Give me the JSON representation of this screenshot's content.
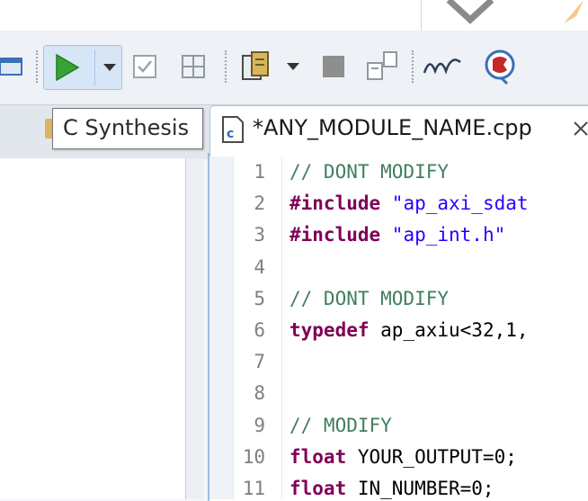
{
  "tooltip": {
    "text": "C Synthesis"
  },
  "editor": {
    "active_tab": {
      "label": "*ANY_MODULE_NAME.cpp"
    },
    "lines": [
      {
        "num": "1",
        "text": "// DONT MODIFY"
      },
      {
        "num": "2",
        "kw": "#include",
        "str": " \"ap_axi_sdat"
      },
      {
        "num": "3",
        "kw": "#include",
        "str": " \"ap_int.h\""
      },
      {
        "num": "4",
        "text": ""
      },
      {
        "num": "5",
        "text": "// DONT MODIFY"
      },
      {
        "num": "6",
        "kw": "typedef",
        "text": " ap_axiu<32,1,"
      },
      {
        "num": "7",
        "text": ""
      },
      {
        "num": "8",
        "text": ""
      },
      {
        "num": "9",
        "text": "// MODIFY"
      },
      {
        "num": "10",
        "kw": "float",
        "text": " YOUR_OUTPUT=0;"
      },
      {
        "num": "11",
        "kw": "float",
        "text": " IN_NUMBER=0;"
      }
    ]
  },
  "toolbar": {
    "icons": [
      "console-icon",
      "run-icon",
      "dropdown-arrow-icon",
      "checkbox-icon",
      "grid-icon",
      "clipboard-icon",
      "dropdown-arrow-icon",
      "stop-icon",
      "layout-icon",
      "waveform-icon",
      "analysis-icon"
    ]
  },
  "colors": {
    "comment": "#3f7f5f",
    "keyword": "#7f0055",
    "string": "#2a00ff",
    "run_green": "#3aa335"
  }
}
